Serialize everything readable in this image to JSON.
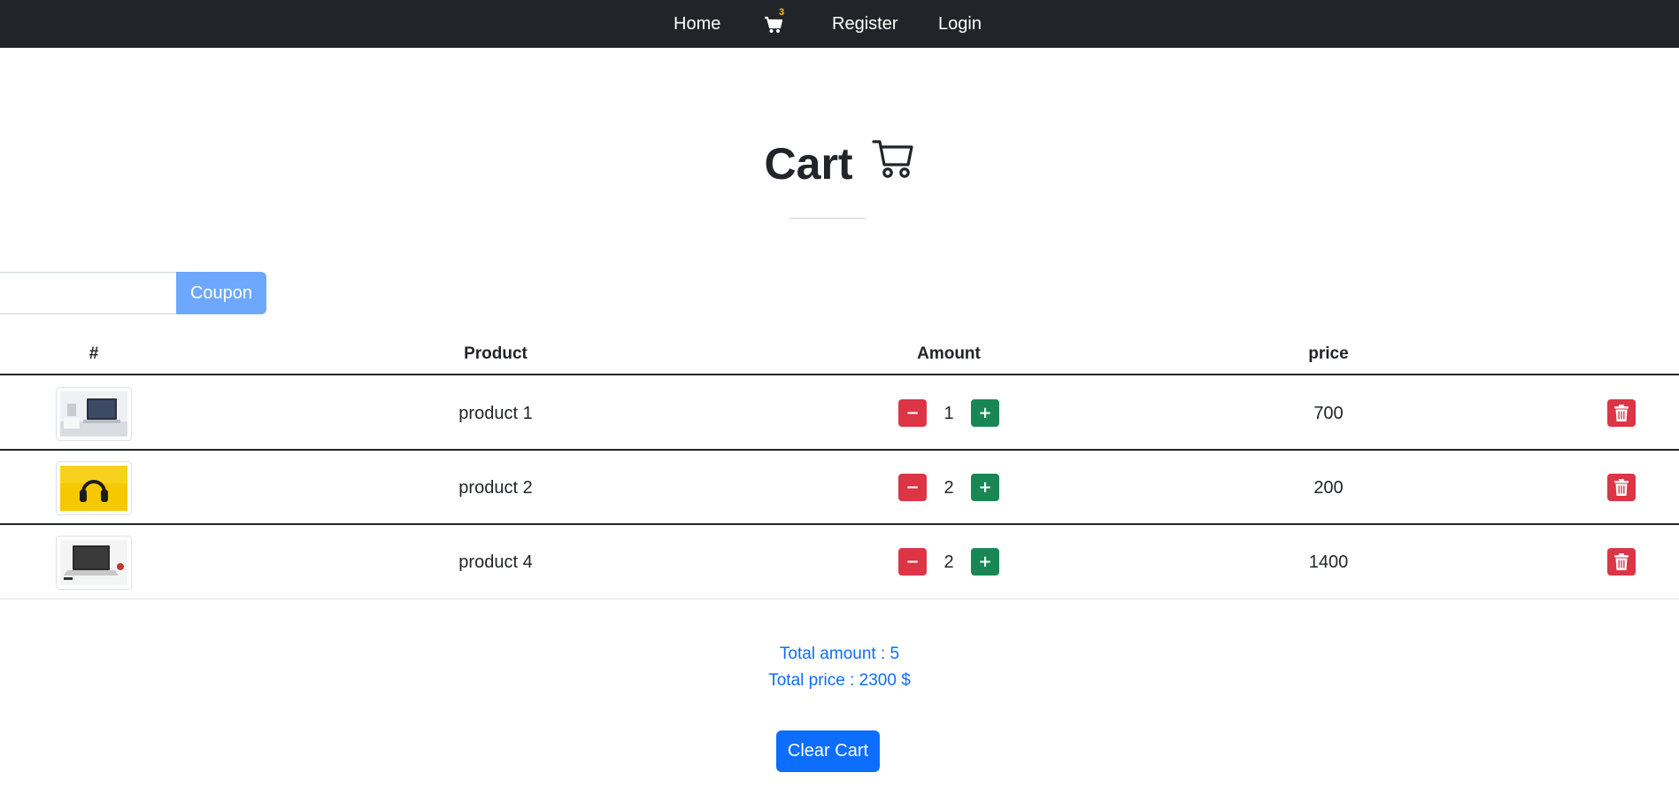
{
  "nav": {
    "home": "Home",
    "cart_count": "3",
    "register": "Register",
    "login": "Login"
  },
  "page": {
    "title": "Cart"
  },
  "coupon": {
    "value": "",
    "placeholder": "",
    "button": "Coupon"
  },
  "table": {
    "headers": {
      "num": "#",
      "product": "Product",
      "amount": "Amount",
      "price": "price"
    },
    "rows": [
      {
        "image": "laptop-desk",
        "product": "product 1",
        "amount": "1",
        "price": "700"
      },
      {
        "image": "yellow-headphones",
        "product": "product 2",
        "amount": "2",
        "price": "200"
      },
      {
        "image": "laptop-apple",
        "product": "product 4",
        "amount": "2",
        "price": "1400"
      }
    ]
  },
  "totals": {
    "amount": "Total amount : 5",
    "price": "Total price : 2300 $"
  },
  "actions": {
    "minus": "−",
    "plus": "+",
    "clear_cart": "Clear Cart"
  },
  "colors": {
    "navbar": "#212529",
    "danger": "#dc3545",
    "success": "#198754",
    "primary": "#0d6efd",
    "coupon": "#6ea8fe",
    "badge": "#ffc107"
  },
  "icons": {
    "nav_cart": "cart-icon",
    "title_cart": "cart-outline-icon",
    "delete": "trash-icon"
  }
}
